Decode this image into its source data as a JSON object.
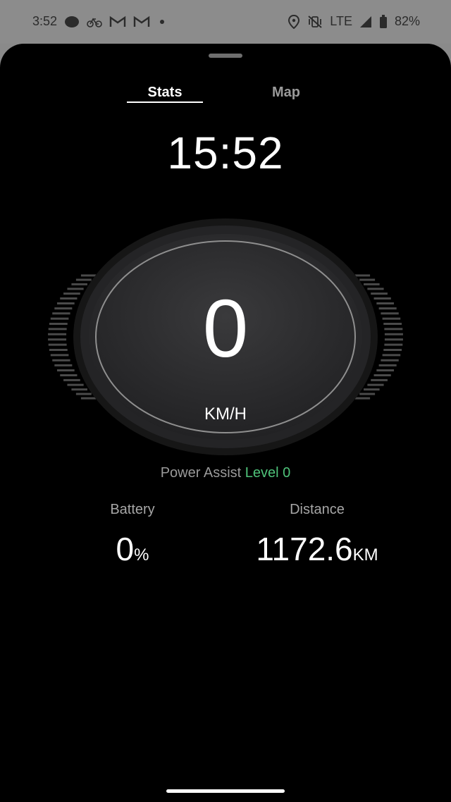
{
  "status_bar": {
    "time": "3:52",
    "network": "LTE",
    "battery": "82%",
    "icons_left": [
      "dot-icon",
      "bicycle-icon",
      "gmail-icon",
      "gmail-icon",
      "small-dot-icon"
    ],
    "icons_right": [
      "location-icon",
      "vibrate-off-icon",
      "signal-icon",
      "battery-icon"
    ]
  },
  "tabs": [
    {
      "label": "Stats",
      "active": true
    },
    {
      "label": "Map",
      "active": false
    }
  ],
  "clock": "15:52",
  "speed": {
    "value": "0",
    "unit": "KM/H"
  },
  "power_assist": {
    "label": "Power Assist",
    "level": "Level 0"
  },
  "stats": {
    "battery": {
      "label": "Battery",
      "value": "0",
      "unit": "%"
    },
    "distance": {
      "label": "Distance",
      "value": "1172.6",
      "unit": "KM"
    }
  },
  "colors": {
    "background": "#000000",
    "accent_green": "#4fc37a",
    "status_bar": "#8c8c8c"
  }
}
